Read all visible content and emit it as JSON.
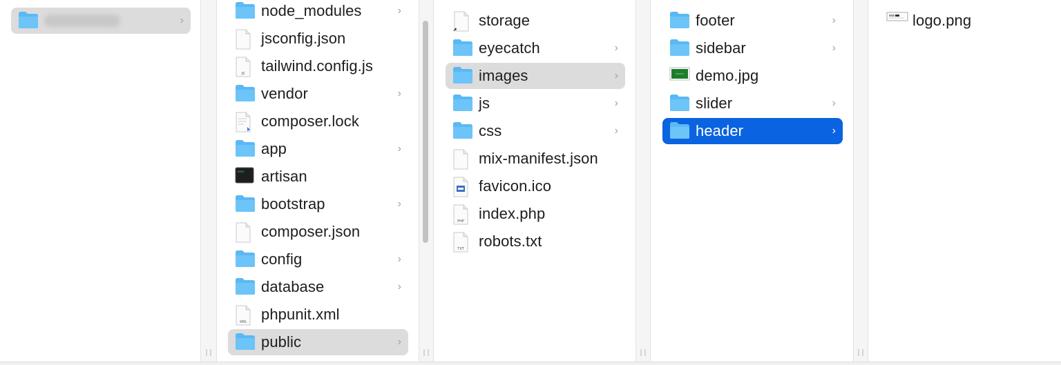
{
  "colors": {
    "folder_blue": "#5ab8f4",
    "selection_gray": "#dcdcdc",
    "selection_blue": "#0a63e0"
  },
  "columns": [
    {
      "name": "root",
      "items": [
        {
          "icon": "folder-icon",
          "redacted": true,
          "chevron": true,
          "selected": "gray"
        }
      ]
    },
    {
      "name": "project",
      "items": [
        {
          "label": "node_modules",
          "icon": "folder-icon",
          "chevron": true
        },
        {
          "label": "jsconfig.json",
          "icon": "file-icon"
        },
        {
          "label": "tailwind.config.js",
          "icon": "js-file-icon"
        },
        {
          "label": "vendor",
          "icon": "folder-icon",
          "chevron": true
        },
        {
          "label": "composer.lock",
          "icon": "lock-file-icon"
        },
        {
          "label": "app",
          "icon": "folder-icon",
          "chevron": true
        },
        {
          "label": "artisan",
          "icon": "terminal-icon"
        },
        {
          "label": "bootstrap",
          "icon": "folder-icon",
          "chevron": true
        },
        {
          "label": "composer.json",
          "icon": "file-icon"
        },
        {
          "label": "config",
          "icon": "folder-icon",
          "chevron": true
        },
        {
          "label": "database",
          "icon": "folder-icon",
          "chevron": true
        },
        {
          "label": "phpunit.xml",
          "icon": "xml-file-icon"
        },
        {
          "label": "public",
          "icon": "folder-icon",
          "chevron": true,
          "selected": "gray"
        }
      ]
    },
    {
      "name": "public",
      "items": [
        {
          "label": "storage",
          "icon": "alias-file-icon"
        },
        {
          "label": "eyecatch",
          "icon": "folder-icon",
          "chevron": true
        },
        {
          "label": "images",
          "icon": "folder-icon",
          "chevron": true,
          "selected": "gray"
        },
        {
          "label": "js",
          "icon": "folder-icon",
          "chevron": true
        },
        {
          "label": "css",
          "icon": "folder-icon",
          "chevron": true
        },
        {
          "label": "mix-manifest.json",
          "icon": "file-icon"
        },
        {
          "label": "favicon.ico",
          "icon": "ico-file-icon"
        },
        {
          "label": "index.php",
          "icon": "php-file-icon"
        },
        {
          "label": "robots.txt",
          "icon": "txt-file-icon"
        }
      ]
    },
    {
      "name": "images",
      "items": [
        {
          "label": "footer",
          "icon": "folder-icon",
          "chevron": true
        },
        {
          "label": "sidebar",
          "icon": "folder-icon",
          "chevron": true
        },
        {
          "label": "demo.jpg",
          "icon": "image-thumbnail-icon"
        },
        {
          "label": "slider",
          "icon": "folder-icon",
          "chevron": true
        },
        {
          "label": "header",
          "icon": "folder-icon",
          "chevron": true,
          "selected": "blue"
        }
      ]
    },
    {
      "name": "header",
      "items": [
        {
          "label": "logo.png",
          "icon": "logo-thumbnail-icon"
        }
      ]
    }
  ],
  "chevron_glyph": "›"
}
